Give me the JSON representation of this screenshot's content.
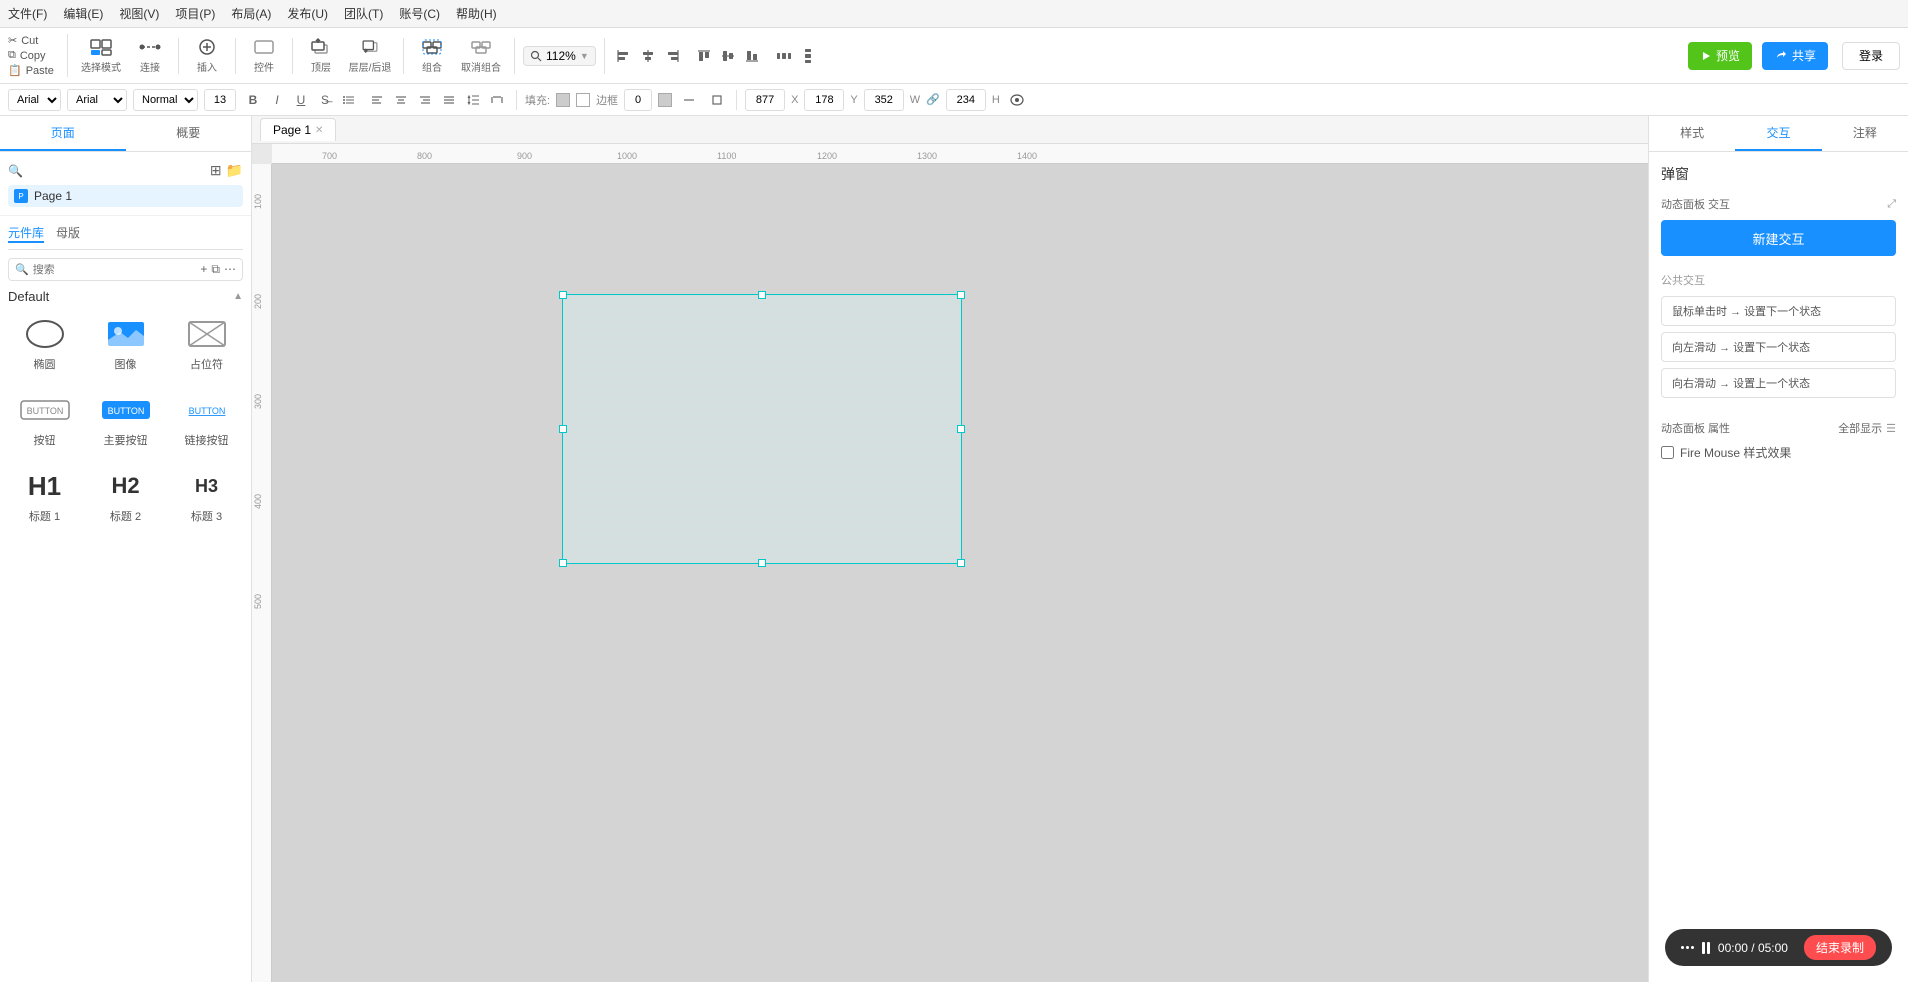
{
  "menubar": {
    "items": [
      "文件(F)",
      "编辑(E)",
      "视图(V)",
      "项目(P)",
      "布局(A)",
      "发布(U)",
      "团队(T)",
      "账号(C)",
      "帮助(H)"
    ]
  },
  "toolbar": {
    "cut_label": "Cut",
    "copy_label": "Copy",
    "paste_label": "Paste",
    "select_mode_label": "选择模式",
    "connect_label": "连接",
    "insert_label": "插入",
    "control_label": "控件",
    "top_label": "顶层",
    "layer_label": "层层/后退",
    "group_label": "组合",
    "ungroup_label": "取消组合",
    "zoom_label": "112%",
    "left_label": "左",
    "center_label": "居中",
    "right_label": "右",
    "top_align_label": "顶端",
    "middle_label": "居中",
    "bottom_label": "底端",
    "distribute_h": "横向",
    "distribute_v": "纵向",
    "preview_label": "预览",
    "share_label": "共享",
    "login_label": "登录"
  },
  "propbar": {
    "font_family": "Arial",
    "font_style": "Normal",
    "font_size": "13",
    "fill_label": "填充:",
    "border_label": "边框",
    "border_value": "0",
    "x_value": "877",
    "y_value": "178",
    "w_value": "352",
    "h_value": "234",
    "x_label": "X",
    "y_label": "Y",
    "w_label": "W",
    "h_label": "H"
  },
  "left_panel": {
    "tab1": "页面",
    "tab2": "概要",
    "page_name": "Page 1",
    "comp_tabs": [
      "元件库",
      "母版"
    ],
    "search_placeholder": "搜索",
    "section_title": "Default",
    "components": [
      {
        "id": "ellipse",
        "label": "椭圆",
        "type": "ellipse"
      },
      {
        "id": "image",
        "label": "图像",
        "type": "image"
      },
      {
        "id": "placeholder",
        "label": "占位符",
        "type": "placeholder"
      },
      {
        "id": "button",
        "label": "按钮",
        "type": "button"
      },
      {
        "id": "primary-button",
        "label": "主要按钮",
        "type": "primary-button"
      },
      {
        "id": "link-button",
        "label": "链接按钮",
        "type": "link-button"
      },
      {
        "id": "h1",
        "label": "标题 1",
        "type": "h1"
      },
      {
        "id": "h2",
        "label": "标题 2",
        "type": "h2"
      },
      {
        "id": "h3",
        "label": "标题 3",
        "type": "h3"
      }
    ]
  },
  "canvas": {
    "page_tab": "Page 1"
  },
  "ruler": {
    "marks_h": [
      "700",
      "800",
      "900",
      "1000",
      "1100",
      "1200",
      "1300",
      "1400"
    ],
    "marks_v": [
      "100",
      "200",
      "300",
      "400",
      "500"
    ]
  },
  "right_panel": {
    "tabs": [
      "样式",
      "交互",
      "注释"
    ],
    "active_tab": "交互",
    "section_title": "弹窗",
    "dynamic_panel_interaction": "动态面板 交互",
    "new_interaction_btn": "新建交互",
    "public_interaction_label": "公共交互",
    "interactions": [
      {
        "text": "鼠标单击时 → 设置下一个状态"
      },
      {
        "text": "向左滑动 → 设置下一个状态"
      },
      {
        "text": "向右滑动 → 设置上一个状态"
      }
    ],
    "dynamic_panel_attr": "动态面板 属性",
    "show_all_label": "全部显示",
    "fire_mouse_label": "Fire Mouse 样式效果",
    "fire_mouse_checked": false
  },
  "record_bar": {
    "time": "00:00 / 05:00",
    "end_btn": "结束录制"
  }
}
